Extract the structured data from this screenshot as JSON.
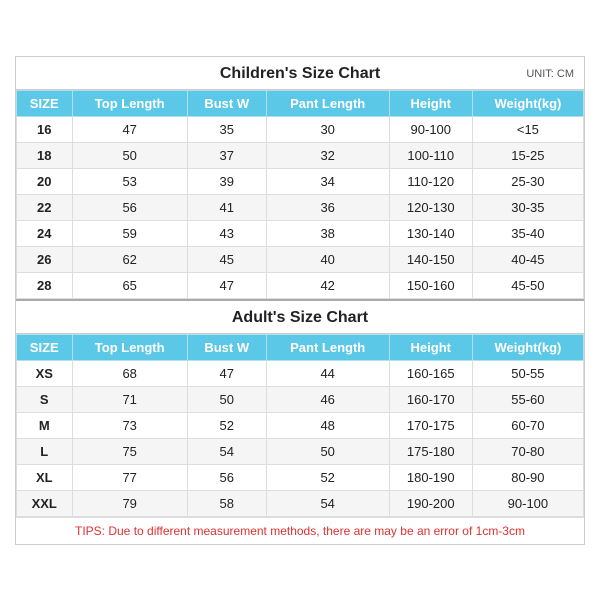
{
  "children_title": "Children's Size Chart",
  "adult_title": "Adult's Size Chart",
  "unit_label": "UNIT: CM",
  "headers": [
    "SIZE",
    "Top Length",
    "Bust W",
    "Pant Length",
    "Height",
    "Weight(kg)"
  ],
  "children_rows": [
    {
      "size": "16",
      "top_length": "47",
      "bust_w": "35",
      "pant_length": "30",
      "height": "90-100",
      "weight": "<15"
    },
    {
      "size": "18",
      "top_length": "50",
      "bust_w": "37",
      "pant_length": "32",
      "height": "100-110",
      "weight": "15-25"
    },
    {
      "size": "20",
      "top_length": "53",
      "bust_w": "39",
      "pant_length": "34",
      "height": "110-120",
      "weight": "25-30"
    },
    {
      "size": "22",
      "top_length": "56",
      "bust_w": "41",
      "pant_length": "36",
      "height": "120-130",
      "weight": "30-35"
    },
    {
      "size": "24",
      "top_length": "59",
      "bust_w": "43",
      "pant_length": "38",
      "height": "130-140",
      "weight": "35-40"
    },
    {
      "size": "26",
      "top_length": "62",
      "bust_w": "45",
      "pant_length": "40",
      "height": "140-150",
      "weight": "40-45"
    },
    {
      "size": "28",
      "top_length": "65",
      "bust_w": "47",
      "pant_length": "42",
      "height": "150-160",
      "weight": "45-50"
    }
  ],
  "adult_rows": [
    {
      "size": "XS",
      "top_length": "68",
      "bust_w": "47",
      "pant_length": "44",
      "height": "160-165",
      "weight": "50-55"
    },
    {
      "size": "S",
      "top_length": "71",
      "bust_w": "50",
      "pant_length": "46",
      "height": "160-170",
      "weight": "55-60"
    },
    {
      "size": "M",
      "top_length": "73",
      "bust_w": "52",
      "pant_length": "48",
      "height": "170-175",
      "weight": "60-70"
    },
    {
      "size": "L",
      "top_length": "75",
      "bust_w": "54",
      "pant_length": "50",
      "height": "175-180",
      "weight": "70-80"
    },
    {
      "size": "XL",
      "top_length": "77",
      "bust_w": "56",
      "pant_length": "52",
      "height": "180-190",
      "weight": "80-90"
    },
    {
      "size": "XXL",
      "top_length": "79",
      "bust_w": "58",
      "pant_length": "54",
      "height": "190-200",
      "weight": "90-100"
    }
  ],
  "tips": "TIPS: Due to different measurement methods, there are may be an error of 1cm-3cm"
}
